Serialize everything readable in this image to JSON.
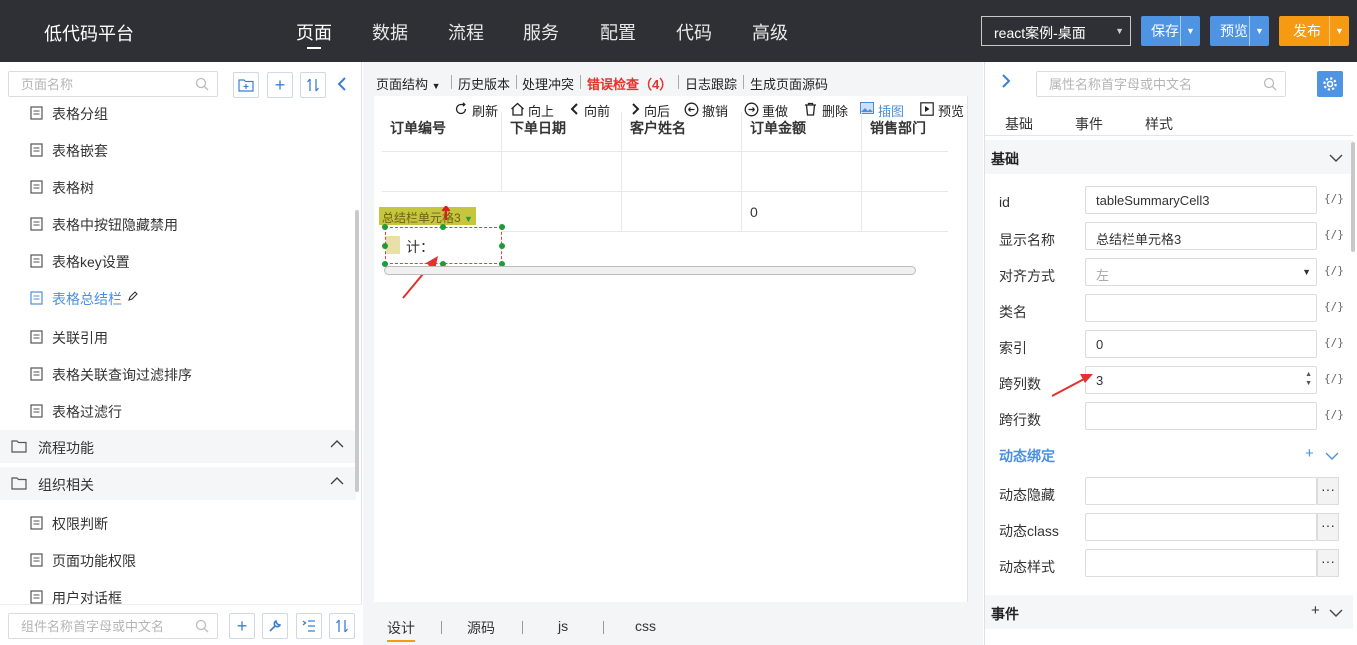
{
  "topbar": {
    "brand": "低代码平台",
    "nav": [
      "页面",
      "数据",
      "流程",
      "服务",
      "配置",
      "代码",
      "高级"
    ],
    "project": "react案例-桌面",
    "save": "保存",
    "preview": "预览",
    "publish": "发布"
  },
  "left": {
    "search_placeholder": "页面名称",
    "bottom_search_placeholder": "组件名称首字母或中文名",
    "items": [
      "表格分组",
      "表格嵌套",
      "表格树",
      "表格中按钮隐藏禁用",
      "表格key设置",
      "表格总结栏",
      "关联引用",
      "表格关联查询过滤排序",
      "表格过滤行"
    ],
    "groups": [
      "流程功能",
      "组织相关"
    ],
    "sub_items": [
      "权限判断",
      "页面功能权限",
      "用户对话框"
    ]
  },
  "center": {
    "toolbar": [
      "页面结构",
      "历史版本",
      "处理冲突",
      "错误检查（4）",
      "日志跟踪",
      "生成页面源码"
    ],
    "canvas_tools": [
      "刷新",
      "向上",
      "向前",
      "向后",
      "撤销",
      "重做",
      "删除",
      "插图",
      "预览"
    ],
    "columns": [
      "订单编号",
      "下单日期",
      "客户姓名",
      "订单金额",
      "销售部门"
    ],
    "summary_label": "计：",
    "summary_value": "0",
    "selected_tag": "总结栏单元格3",
    "tabs": [
      "设计",
      "源码",
      "js",
      "css"
    ]
  },
  "right": {
    "search_placeholder": "属性名称首字母或中文名",
    "tabs": [
      "基础",
      "事件",
      "样式"
    ],
    "section_basic": "基础",
    "props": [
      {
        "label": "id",
        "value": "tableSummaryCell3"
      },
      {
        "label": "显示名称",
        "value": "总结栏单元格3"
      },
      {
        "label": "对齐方式",
        "value": "左"
      },
      {
        "label": "类名",
        "value": ""
      },
      {
        "label": "索引",
        "value": "0"
      },
      {
        "label": "跨列数",
        "value": "3"
      },
      {
        "label": "跨行数",
        "value": ""
      }
    ],
    "dynamic_title": "动态绑定",
    "dynamic": [
      "动态隐藏",
      "动态class",
      "动态样式"
    ],
    "fx": "{/}",
    "section_event": "事件"
  },
  "colors": {
    "accent": "#4f93e3",
    "publish": "#f59a12",
    "error": "#e5322d",
    "topbar": "#2e3035"
  }
}
